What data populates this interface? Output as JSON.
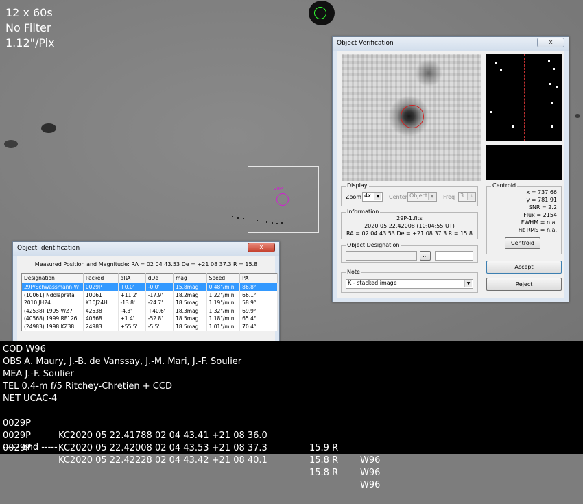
{
  "overlay": {
    "exposure": "12 x 60s",
    "filter": "No Filter",
    "scale": "1.12\"/Pix"
  },
  "object_identification": {
    "title": "Object Identification",
    "close": "x",
    "measured": "Measured Position and Magnitude: RA = 02 04 43.53   De = +21 08 37.3   R = 15.8",
    "columns": [
      "Designation",
      "Packed",
      "dRA",
      "dDe",
      "mag",
      "Speed",
      "PA"
    ],
    "rows": [
      {
        "designation": "29P/Schwassmann-W",
        "packed": "0029P",
        "dra": "+0.0'",
        "dde": "-0.0'",
        "mag": "15.8mag",
        "speed": "0.48\"/min",
        "pa": "86.8°"
      },
      {
        "designation": "(10061) Ndolaprata",
        "packed": "10061",
        "dra": "+11.2'",
        "dde": "-17.9'",
        "mag": "18.2mag",
        "speed": "1.22\"/min",
        "pa": "66.1°"
      },
      {
        "designation": "2010 JH24",
        "packed": "K10J24H",
        "dra": "-13.8'",
        "dde": "-24.7'",
        "mag": "18.5mag",
        "speed": "1.19\"/min",
        "pa": "58.9°"
      },
      {
        "designation": "(42538) 1995 WZ7",
        "packed": "42538",
        "dra": "-4.3'",
        "dde": "+40.6'",
        "mag": "18.3mag",
        "speed": "1.32\"/min",
        "pa": "69.9°"
      },
      {
        "designation": "(40568) 1999 RF126",
        "packed": "40568",
        "dra": "+1.4'",
        "dde": "-52.8'",
        "mag": "18.5mag",
        "speed": "1.18\"/min",
        "pa": "65.4°"
      },
      {
        "designation": "(24983) 1998 KZ38",
        "packed": "24983",
        "dra": "+55.5'",
        "dde": "-5.5'",
        "mag": "18.5mag",
        "speed": "1.01\"/min",
        "pa": "70.4°"
      }
    ]
  },
  "object_verification": {
    "title": "Object Verification",
    "close": "x",
    "display": {
      "title": "Display",
      "zoom_label": "Zoom",
      "zoom_value": "4x",
      "center_label": "Center",
      "center_value": "Object",
      "freq_label": "Freq",
      "freq_value": "3"
    },
    "information": {
      "title": "Information",
      "file": "29P-1.fits",
      "date": "2020 05 22.42008 (10:04:55 UT)",
      "position": "RA = 02 04 43.53   De = +21 08 37.3   R = 15.8"
    },
    "designation": {
      "title": "Object Designation",
      "browse": "..."
    },
    "note": {
      "title": "Note",
      "value": "K - stacked image"
    },
    "centroid": {
      "title": "Centroid",
      "x": "x = 737.66",
      "y": "y = 781.91",
      "snr": "SNR = 2.2",
      "flux": "Flux = 2154",
      "fwhm": "FWHM = n.a.",
      "fit_rms": "Fit RMS = n.a.",
      "button": "Centroid"
    },
    "accept": "Accept",
    "reject": "Reject"
  },
  "report": {
    "header_lines": [
      "COD W96",
      "OBS A. Maury, J.-B. de Vanssay, J.-M. Mari, J.-F. Soulier",
      "MEA J.-F. Soulier",
      "TEL 0.4-m f/5 Ritchey-Chretien + CCD",
      "NET UCAC-4"
    ],
    "observations": [
      {
        "object": "0029P",
        "data": "KC2020 05 22.41788 02 04 43.41 +21 08 36.0",
        "mag": "15.9 R",
        "code": "W96"
      },
      {
        "object": "0029P",
        "data": "KC2020 05 22.42008 02 04 43.53 +21 08 37.3",
        "mag": "15.8 R",
        "code": "W96"
      },
      {
        "object": "0029P",
        "data": "KC2020 05 22.42228 02 04 43.42 +21 08 40.1",
        "mag": "15.8 R",
        "code": "W96"
      }
    ],
    "end": "----- end -----"
  }
}
